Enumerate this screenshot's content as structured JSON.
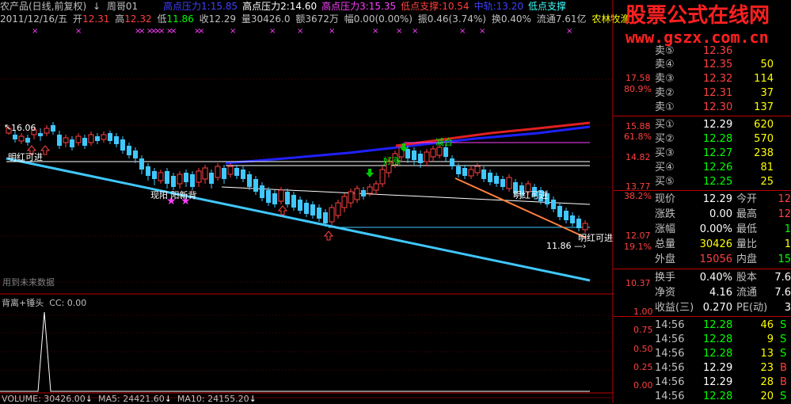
{
  "header": {
    "title": "农产品(日线,前复权)",
    "indicator": "周哥01",
    "levels": [
      {
        "label": "高点压力1:",
        "value": "15.85",
        "color": "#4040ff"
      },
      {
        "label": "高点压力2:",
        "value": "14.60",
        "color": "#ffffff"
      },
      {
        "label": "高点压力3:",
        "value": "15.35",
        "color": "#ff40ff"
      },
      {
        "label": "低点支撑:",
        "value": "10.54",
        "color": "#ff4040"
      },
      {
        "label": "中轨:",
        "value": "13.20",
        "color": "#4040ff"
      },
      {
        "label": "低点支撑",
        "value": "",
        "color": "#40ffff"
      }
    ]
  },
  "info": {
    "date": "2011/12/16/五",
    "open_label": "开",
    "open": "12.31",
    "high_label": "高",
    "high": "12.32",
    "low_label": "低",
    "low": "11.86",
    "close_label": "收",
    "close": "12.29",
    "volume_label": "量",
    "volume": "30426.0",
    "amount_label": "额",
    "amount": "3672万",
    "change_label": "幅",
    "change": "0.00(0.00%)",
    "amplitude_label": "振",
    "amplitude": "0.46(3.74%)",
    "turnover_label": "换",
    "turnover": "0.40%",
    "float_label": "流通",
    "float": "7.61亿",
    "sector": "农林牧渔"
  },
  "logo": {
    "cn": "股票公式在线网",
    "url": "www.gszx.com.cn"
  },
  "price_axis": [
    "17.58",
    "80.9%",
    "15.88",
    "61.8%",
    "14.82",
    "13.77",
    "38.2%",
    "12.07",
    "19.1%",
    "10.37"
  ],
  "chart_labels": {
    "high_mark": "16.06",
    "low_mark": "11.86",
    "future_data": "用到未来数据",
    "signal_1": "明红可进",
    "signal_2": "明红可进",
    "signal_3": "明红可进",
    "signal_4": "明红可进",
    "signal_5": "现阳 阳新背",
    "signal_6": "好涨",
    "signal_7": "减合"
  },
  "subpanel": {
    "title": "背离+锤头",
    "cc": "CC: 0.00",
    "axis": [
      "1.00",
      "0.75",
      "0.50",
      "0.25",
      "0.00"
    ]
  },
  "volume_bar": {
    "volume": "VOLUME: 30426.00",
    "ma5": "MA5: 24421.60",
    "ma10": "MA10: 24155.20"
  },
  "quote": {
    "asks": [
      {
        "label": "卖⑤",
        "price": "12.36",
        "vol": ""
      },
      {
        "label": "卖④",
        "price": "12.35",
        "vol": "50"
      },
      {
        "label": "卖③",
        "price": "12.32",
        "vol": "114"
      },
      {
        "label": "卖②",
        "price": "12.31",
        "vol": "37"
      },
      {
        "label": "卖①",
        "price": "12.30",
        "vol": "137"
      }
    ],
    "bids": [
      {
        "label": "买①",
        "price": "12.29",
        "vol": "620"
      },
      {
        "label": "买②",
        "price": "12.28",
        "vol": "570"
      },
      {
        "label": "买③",
        "price": "12.27",
        "vol": "238"
      },
      {
        "label": "买④",
        "price": "12.26",
        "vol": "81"
      },
      {
        "label": "买⑤",
        "price": "12.25",
        "vol": "25"
      }
    ],
    "stats": [
      {
        "l1": "现价",
        "v1": "12.29",
        "l2": "今开",
        "v2": "12",
        "c1": "#ffffff",
        "c2": "#ff4040"
      },
      {
        "l1": "涨跌",
        "v1": "0.00",
        "l2": "最高",
        "v2": "12",
        "c1": "#ffffff",
        "c2": "#ff4040"
      },
      {
        "l1": "涨幅",
        "v1": "0.00%",
        "l2": "最低",
        "v2": "1",
        "c1": "#ffffff",
        "c2": "#00ff00"
      },
      {
        "l1": "总量",
        "v1": "30426",
        "l2": "量比",
        "v2": "1",
        "c1": "#ffff00",
        "c2": "#ffff00"
      },
      {
        "l1": "外盘",
        "v1": "15056",
        "l2": "内盘",
        "v2": "15",
        "c1": "#ff4040",
        "c2": "#00ff00"
      }
    ],
    "stats2": [
      {
        "l1": "换手",
        "v1": "0.40%",
        "l2": "股本",
        "v2": "7.6"
      },
      {
        "l1": "净资",
        "v1": "4.16",
        "l2": "流通",
        "v2": "7.6"
      },
      {
        "l1": "收益(三)",
        "v1": "0.270",
        "l2": "PE(动)",
        "v2": "3"
      }
    ],
    "ticks": [
      {
        "time": "14:56",
        "price": "12.28",
        "vol": "46",
        "side": "S"
      },
      {
        "time": "14:56",
        "price": "12.28",
        "vol": "9",
        "side": "S"
      },
      {
        "time": "14:56",
        "price": "12.28",
        "vol": "13",
        "side": "S"
      },
      {
        "time": "14:56",
        "price": "12.29",
        "vol": "23",
        "side": "B"
      },
      {
        "time": "14:56",
        "price": "12.29",
        "vol": "28",
        "side": "B"
      },
      {
        "time": "14:56",
        "price": "12.28",
        "vol": "20",
        "side": "S"
      }
    ]
  }
}
